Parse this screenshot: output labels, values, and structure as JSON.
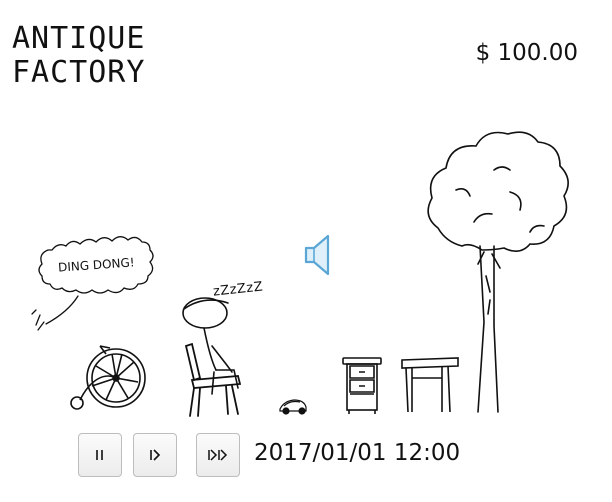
{
  "game": {
    "title_line1": "ANTIQUE",
    "title_line2": "FACTORY",
    "money": "$ 100.00",
    "speech": "DING DONG!",
    "sleep": "zZzZzZ",
    "datetime": "2017/01/01 12:00"
  },
  "controls": {
    "pause_icon": "pause-icon",
    "play_icon": "play-icon",
    "fast_forward_icon": "fast-forward-icon",
    "sound_icon": "speaker-icon"
  },
  "colors": {
    "ink": "#111111",
    "button_border": "#bdbdbd",
    "speaker_blue": "#5aa7d6"
  }
}
